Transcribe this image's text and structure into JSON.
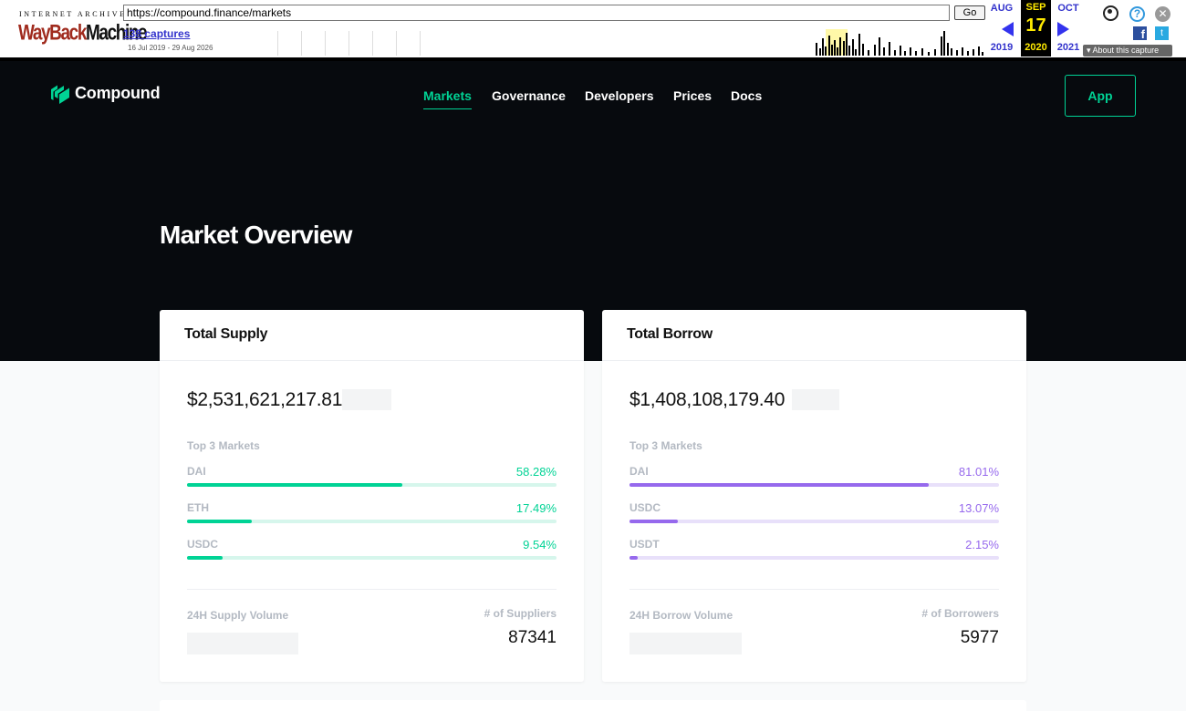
{
  "wayback": {
    "logo_top": "INTERNET ARCHIVE",
    "logo_wayback": "WayBack",
    "logo_machine": "Machine",
    "url": "https://compound.finance/markets",
    "go_label": "Go",
    "captures": "138 captures",
    "range": "16 Jul 2019 - 29 Aug 2026",
    "prev_month": "AUG",
    "cur_month": "SEP",
    "next_month": "OCT",
    "cur_day": "17",
    "prev_year": "2019",
    "cur_year": "2020",
    "next_year": "2021",
    "about": "About this capture",
    "icons": [
      "user-icon",
      "help-icon",
      "close-icon",
      "facebook-icon",
      "twitter-icon"
    ]
  },
  "nav": {
    "brand": "Compound",
    "items": [
      "Markets",
      "Governance",
      "Developers",
      "Prices",
      "Docs"
    ],
    "active": "Markets",
    "app_button": "App"
  },
  "page": {
    "title": "Market Overview"
  },
  "supply": {
    "title": "Total Supply",
    "total": "$2,531,621,217.81",
    "top3_label": "Top 3 Markets",
    "markets": [
      {
        "name": "DAI",
        "percent": "58.28%",
        "share": 0.5828
      },
      {
        "name": "ETH",
        "percent": "17.49%",
        "share": 0.1749
      },
      {
        "name": "USDC",
        "percent": "9.54%",
        "share": 0.0954
      }
    ],
    "volume_label": "24H Supply Volume",
    "count_label": "# of Suppliers",
    "count": "87341"
  },
  "borrow": {
    "title": "Total Borrow",
    "total": "$1,408,108,179.40",
    "top3_label": "Top 3 Markets",
    "markets": [
      {
        "name": "DAI",
        "percent": "81.01%",
        "share": 0.8101
      },
      {
        "name": "USDC",
        "percent": "13.07%",
        "share": 0.1307
      },
      {
        "name": "USDT",
        "percent": "2.15%",
        "share": 0.0215
      }
    ],
    "volume_label": "24H Borrow Volume",
    "count_label": "# of Borrowers",
    "count": "5977"
  },
  "colors": {
    "accent_green": "#00d395",
    "accent_purple": "#9669ed",
    "hero_bg": "#070a0e"
  }
}
